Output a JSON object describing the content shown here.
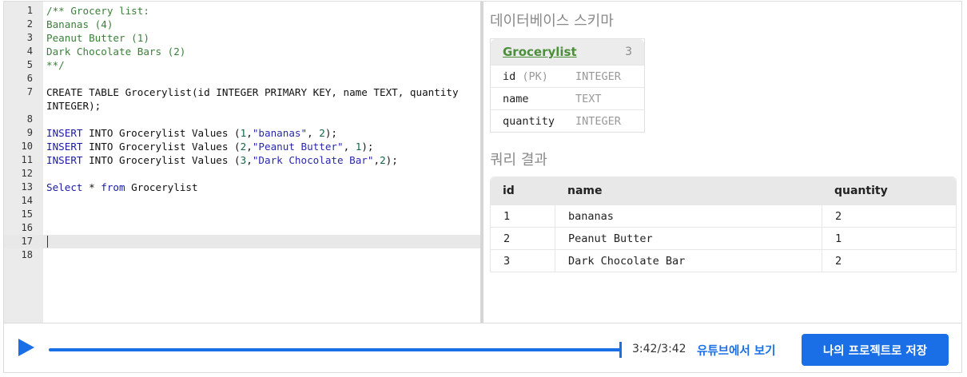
{
  "editor": {
    "lines": [
      {
        "n": "1",
        "parts": [
          {
            "t": "/** Grocery list:",
            "c": "cmt"
          }
        ]
      },
      {
        "n": "2",
        "parts": [
          {
            "t": "Bananas (4)",
            "c": "cmt"
          }
        ]
      },
      {
        "n": "3",
        "parts": [
          {
            "t": "Peanut Butter (1)",
            "c": "cmt"
          }
        ]
      },
      {
        "n": "4",
        "parts": [
          {
            "t": "Dark Chocolate Bars (2)",
            "c": "cmt"
          }
        ]
      },
      {
        "n": "5",
        "parts": [
          {
            "t": "**/",
            "c": "cmt"
          }
        ]
      },
      {
        "n": "6",
        "parts": []
      },
      {
        "n": "7",
        "parts": [
          {
            "t": "CREATE TABLE Grocerylist(id INTEGER PRIMARY KEY, name TEXT, quantity",
            "c": ""
          }
        ]
      },
      {
        "n": "",
        "parts": [
          {
            "t": "INTEGER);",
            "c": ""
          }
        ]
      },
      {
        "n": "8",
        "parts": []
      },
      {
        "n": "9",
        "parts": [
          {
            "t": "INSERT",
            "c": "kw"
          },
          {
            "t": " INTO Grocerylist Values (",
            "c": ""
          },
          {
            "t": "1",
            "c": "num"
          },
          {
            "t": ",",
            "c": ""
          },
          {
            "t": "\"bananas\"",
            "c": "str"
          },
          {
            "t": ", ",
            "c": ""
          },
          {
            "t": "2",
            "c": "num"
          },
          {
            "t": ");",
            "c": ""
          }
        ]
      },
      {
        "n": "10",
        "parts": [
          {
            "t": "INSERT",
            "c": "kw"
          },
          {
            "t": " INTO Grocerylist Values (",
            "c": ""
          },
          {
            "t": "2",
            "c": "num"
          },
          {
            "t": ",",
            "c": ""
          },
          {
            "t": "\"Peanut Butter\"",
            "c": "str"
          },
          {
            "t": ", ",
            "c": ""
          },
          {
            "t": "1",
            "c": "num"
          },
          {
            "t": ");",
            "c": ""
          }
        ]
      },
      {
        "n": "11",
        "parts": [
          {
            "t": "INSERT",
            "c": "kw"
          },
          {
            "t": " INTO Grocerylist Values (",
            "c": ""
          },
          {
            "t": "3",
            "c": "num"
          },
          {
            "t": ",",
            "c": ""
          },
          {
            "t": "\"Dark Chocolate Bar\"",
            "c": "str"
          },
          {
            "t": ",",
            "c": ""
          },
          {
            "t": "2",
            "c": "num"
          },
          {
            "t": ");",
            "c": ""
          }
        ]
      },
      {
        "n": "12",
        "parts": []
      },
      {
        "n": "13",
        "parts": [
          {
            "t": "Select",
            "c": "kw"
          },
          {
            "t": " * ",
            "c": ""
          },
          {
            "t": "from",
            "c": "kw"
          },
          {
            "t": " Grocerylist",
            "c": ""
          }
        ]
      },
      {
        "n": "14",
        "parts": []
      },
      {
        "n": "15",
        "parts": []
      },
      {
        "n": "16",
        "parts": []
      },
      {
        "n": "17",
        "parts": [],
        "active": true
      },
      {
        "n": "18",
        "parts": []
      }
    ]
  },
  "schema": {
    "title": "데이터베이스 스키마",
    "table_name": "Grocerylist",
    "row_count": "3",
    "columns": [
      {
        "name": "id",
        "pk": "(PK)",
        "type": "INTEGER"
      },
      {
        "name": "name",
        "pk": "",
        "type": "TEXT"
      },
      {
        "name": "quantity",
        "pk": "",
        "type": "INTEGER"
      }
    ]
  },
  "results": {
    "title": "쿼리 결과",
    "headers": [
      "id",
      "name",
      "quantity"
    ],
    "rows": [
      [
        "1",
        "bananas",
        "2"
      ],
      [
        "2",
        "Peanut Butter",
        "1"
      ],
      [
        "3",
        "Dark Chocolate Bar",
        "2"
      ]
    ]
  },
  "player": {
    "time": "3:42/3:42",
    "progress": 1.0,
    "youtube_label": "유튜브에서 보기",
    "save_label": "나의 프로젝트로 저장"
  },
  "colors": {
    "accent": "#1a6fe6",
    "table_link": "#4b8f3a",
    "comment": "#3a7f3a",
    "keyword": "#1a1aa6"
  },
  "icons": {
    "play": "play-icon"
  }
}
